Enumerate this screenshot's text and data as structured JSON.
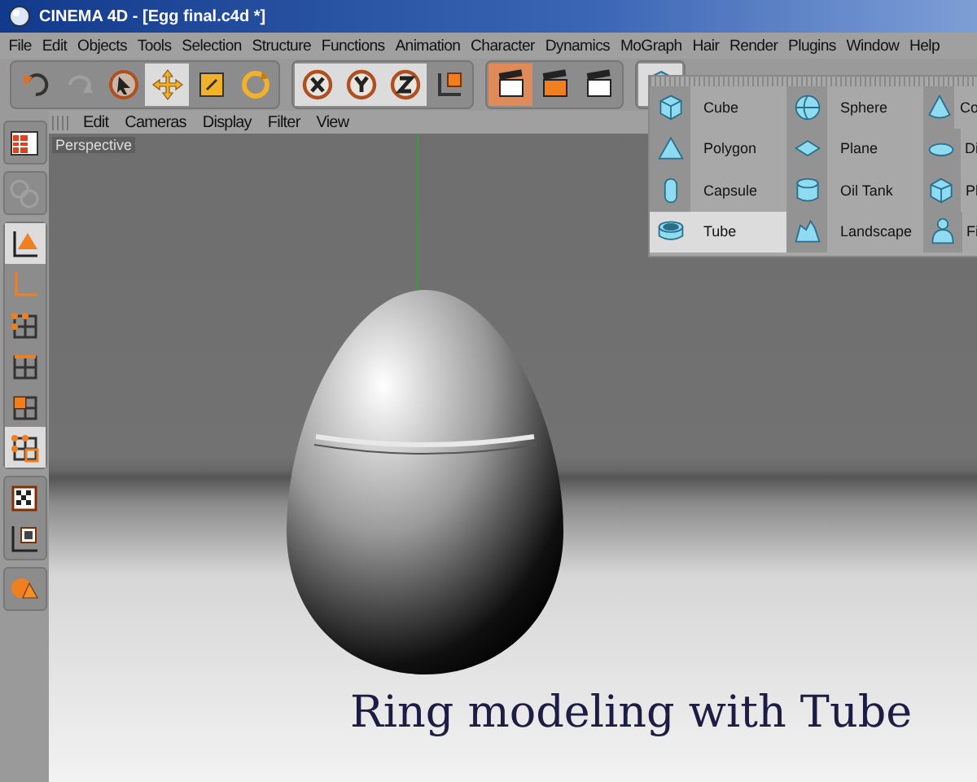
{
  "window": {
    "title": "CINEMA 4D - [Egg final.c4d *]"
  },
  "menu_bar": [
    "File",
    "Edit",
    "Objects",
    "Tools",
    "Selection",
    "Structure",
    "Functions",
    "Animation",
    "Character",
    "Dynamics",
    "MoGraph",
    "Hair",
    "Render",
    "Plugins",
    "Window",
    "Help"
  ],
  "toolbar_groups": [
    [
      {
        "kind": "undo",
        "selected": false,
        "disabled": false
      },
      {
        "kind": "redo",
        "selected": false,
        "disabled": true
      },
      {
        "kind": "select",
        "selected": false,
        "disabled": false
      },
      {
        "kind": "move",
        "selected": true,
        "disabled": false
      },
      {
        "kind": "scale",
        "selected": false,
        "disabled": false
      },
      {
        "kind": "rotate",
        "selected": false,
        "disabled": false
      }
    ],
    [
      {
        "kind": "x",
        "selected": true,
        "disabled": false
      },
      {
        "kind": "y",
        "selected": true,
        "disabled": false
      },
      {
        "kind": "z",
        "selected": true,
        "disabled": false
      },
      {
        "kind": "coords",
        "selected": false,
        "disabled": false
      }
    ],
    [
      {
        "kind": "render",
        "selected": true,
        "disabled": false
      },
      {
        "kind": "render-active",
        "selected": false,
        "disabled": false
      },
      {
        "kind": "render-settings",
        "selected": false,
        "disabled": false
      }
    ],
    [
      {
        "kind": "cube",
        "selected": true,
        "disabled": false
      }
    ]
  ],
  "side_tools": [
    [
      {
        "kind": "layout",
        "selected": false,
        "disabled": false
      }
    ],
    [
      {
        "kind": "edit-disabled",
        "selected": false,
        "disabled": true
      }
    ],
    [
      {
        "kind": "model",
        "selected": true,
        "disabled": false
      },
      {
        "kind": "axis",
        "selected": false,
        "disabled": false
      },
      {
        "kind": "points",
        "selected": false,
        "disabled": false
      },
      {
        "kind": "edges",
        "selected": false,
        "disabled": false
      },
      {
        "kind": "polygons",
        "selected": false,
        "disabled": false
      },
      {
        "kind": "uv",
        "selected": true,
        "disabled": false
      }
    ],
    [
      {
        "kind": "texture",
        "selected": false,
        "disabled": false
      },
      {
        "kind": "texture-axis",
        "selected": false,
        "disabled": false
      }
    ],
    [
      {
        "kind": "sculpt",
        "selected": false,
        "disabled": false
      }
    ]
  ],
  "viewport": {
    "menu": [
      "Edit",
      "Cameras",
      "Display",
      "Filter",
      "View"
    ],
    "label": "Perspective",
    "caption": "Ring modeling with Tube"
  },
  "primitives_menu": [
    {
      "label": "Cube",
      "kind": "cube",
      "selected": false
    },
    {
      "label": "Sphere",
      "kind": "sphere",
      "selected": false
    },
    {
      "label": "Co",
      "kind": "cone",
      "selected": false
    },
    {
      "label": "Polygon",
      "kind": "polygon",
      "selected": false
    },
    {
      "label": "Plane",
      "kind": "plane",
      "selected": false
    },
    {
      "label": "Di",
      "kind": "disc",
      "selected": false
    },
    {
      "label": "Capsule",
      "kind": "capsule",
      "selected": false
    },
    {
      "label": "Oil Tank",
      "kind": "oiltank",
      "selected": false
    },
    {
      "label": "Pl",
      "kind": "platonic",
      "selected": false
    },
    {
      "label": "Tube",
      "kind": "tube",
      "selected": true
    },
    {
      "label": "Landscape",
      "kind": "landscape",
      "selected": false
    },
    {
      "label": "Fi",
      "kind": "figure",
      "selected": false
    }
  ]
}
